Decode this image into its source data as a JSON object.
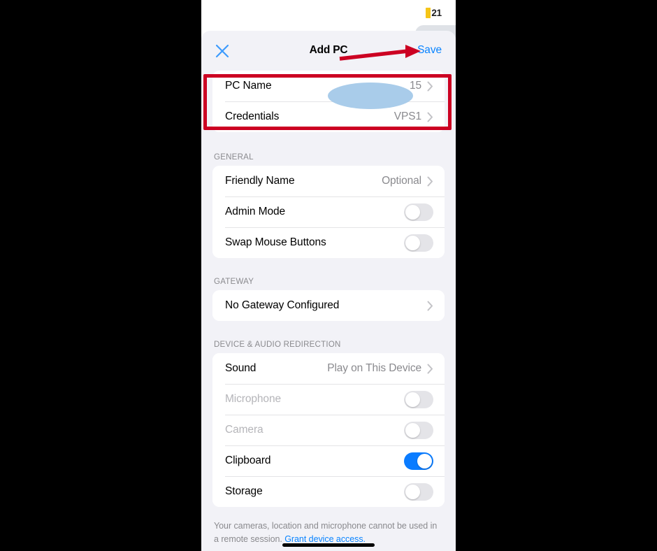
{
  "status_bar": {
    "indicator_icon": "yellow-status-chip",
    "count": "21"
  },
  "nav": {
    "close_icon": "close-icon",
    "title": "Add PC",
    "save_label": "Save"
  },
  "sections": {
    "connection": {
      "rows": [
        {
          "label": "PC Name",
          "value": "15",
          "accessory": "chevron-right-icon",
          "redacted": true
        },
        {
          "label": "Credentials",
          "value": "VPS1",
          "accessory": "chevron-right-icon",
          "redacted": false
        }
      ]
    },
    "general": {
      "header": "GENERAL",
      "rows": [
        {
          "label": "Friendly Name",
          "value": "Optional",
          "accessory": "chevron-right-icon"
        },
        {
          "label": "Admin Mode",
          "toggle": "off"
        },
        {
          "label": "Swap Mouse Buttons",
          "toggle": "off"
        }
      ]
    },
    "gateway": {
      "header": "GATEWAY",
      "rows": [
        {
          "label": "No Gateway Configured",
          "accessory": "chevron-right-icon"
        }
      ]
    },
    "redirection": {
      "header": "DEVICE & AUDIO REDIRECTION",
      "rows": [
        {
          "label": "Sound",
          "value": "Play on This Device",
          "accessory": "chevron-right-icon"
        },
        {
          "label": "Microphone",
          "toggle": "off",
          "disabled": true
        },
        {
          "label": "Camera",
          "toggle": "off",
          "disabled": true
        },
        {
          "label": "Clipboard",
          "toggle": "on"
        },
        {
          "label": "Storage",
          "toggle": "off"
        }
      ]
    }
  },
  "footnote": {
    "text": "Your cameras, location and microphone cannot be used in a remote session. ",
    "link": "Grant device access."
  },
  "annotations": {
    "highlight_box_color": "#cc0022",
    "arrow_color": "#cc0022",
    "redaction_color": "#a9ccea"
  },
  "colors": {
    "accent_blue": "#0a84ff",
    "toggle_on": "#0a7cff",
    "page_background": "#f2f2f7",
    "card_background": "#ffffff",
    "secondary_text": "#8a8a8e"
  }
}
